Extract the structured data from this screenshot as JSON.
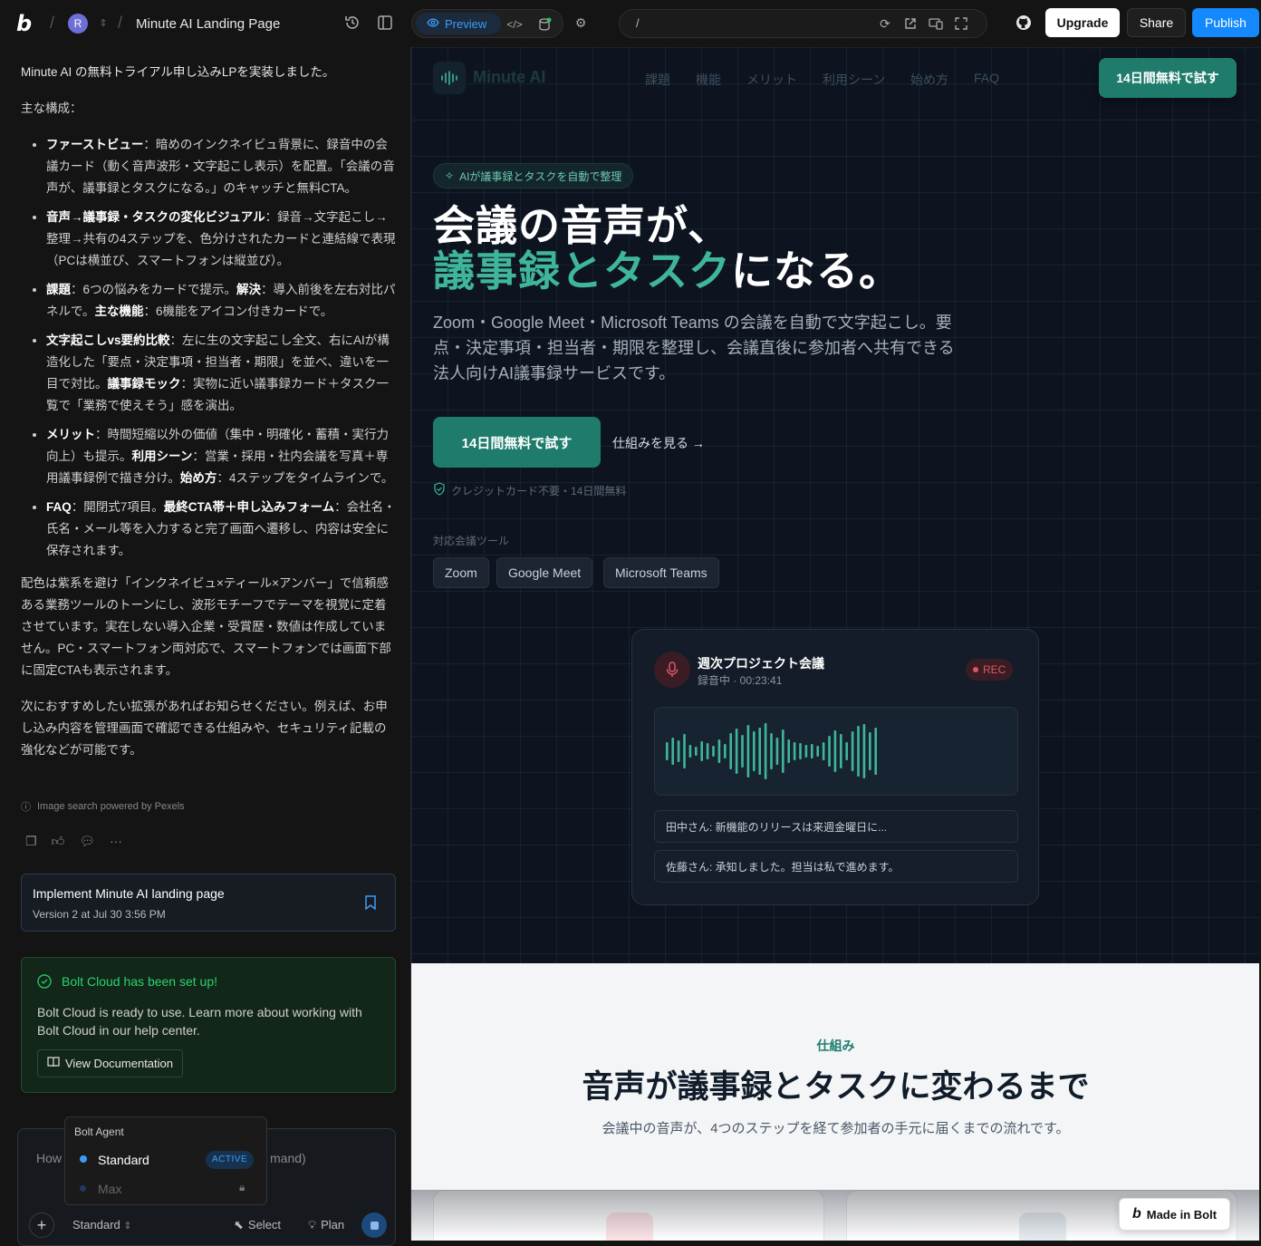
{
  "topbar": {
    "avatar_initial": "R",
    "project_title": "Minute AI Landing Page",
    "preview_label": "Preview",
    "url_path": "/",
    "upgrade_label": "Upgrade",
    "share_label": "Share",
    "publish_label": "Publish"
  },
  "chat": {
    "intro": "Minute AI の無料トライアル申し込みLPを実装しました。",
    "structure_heading": "主な構成：",
    "bullets": [
      {
        "bold": "ファーストビュー",
        "text": "：暗めのインクネイビュ背景に、録音中の会議カード（動く音声波形・文字起こし表示）を配置。「会議の音声が、議事録とタスクになる。」のキャッチと無料CTA。"
      },
      {
        "bold": "音声→議事録・タスクの変化ビジュアル",
        "text": "：録音→文字起こし→整理→共有の4ステップを、色分けされたカードと連結線で表現（PCは横並び、スマートフォンは縦並び）。"
      },
      {
        "bold": "課題",
        "text": "：6つの悩みをカードで提示。",
        "bold2": "解決",
        "text2": "：導入前後を左右対比パネルで。",
        "bold3": "主な機能",
        "text3": "：6機能をアイコン付きカードで。"
      },
      {
        "bold": "文字起こしvs要約比較",
        "text": "：左に生の文字起こし全文、右にAIが構造化した「要点・決定事項・担当者・期限」を並べ、違いを一目で対比。",
        "bold2": "議事録モック",
        "text2": "：実物に近い議事録カード＋タスク一覧で「業務で使えそう」感を演出。"
      },
      {
        "bold": "メリット",
        "text": "：時間短縮以外の価値（集中・明確化・蓄積・実行力向上）も提示。",
        "bold2": "利用シーン",
        "text2": "：営業・採用・社内会議を写真＋専用議事録例で描き分け。",
        "bold3": "始め方",
        "text3": "：4ステップをタイムラインで。"
      },
      {
        "bold": "FAQ",
        "text": "：開閉式7項目。",
        "bold2": "最終CTA帯＋申し込みフォーム",
        "text2": "：会社名・氏名・メール等を入力すると完了画面へ遷移し、内容は安全に保存されます。"
      }
    ],
    "para_color": "配色は紫系を避け「インクネイビュ×ティール×アンバー」で信頼感ある業務ツールのトーンにし、波形モチーフでテーマを視覚に定着させています。実在しない導入企業・受賞歴・数値は作成していません。PC・スマートフォン両対応で、スマートフォンでは画面下部に固定CTAも表示されます。",
    "para_next": "次におすすめしたい拡張があればお知らせください。例えば、お申し込み内容を管理画面で確認できる仕組みや、セキュリティ記載の強化などが可能です。",
    "pexels_note": "Image search powered by Pexels",
    "version_title": "Implement Minute AI landing page",
    "version_meta": "Version 2 at Jul 30 3:56 PM",
    "cloud_title": "Bolt Cloud has been set up!",
    "cloud_body": "Bolt Cloud is ready to use. Learn more about working with Bolt Cloud in our help center.",
    "cloud_button": "View Documentation",
    "input_placeholder_left": "How",
    "input_placeholder_right": "mand)",
    "agent_menu_title": "Bolt Agent",
    "agent_standard": "Standard",
    "agent_active_badge": "ACTIVE",
    "agent_max": "Max",
    "mode_label": "Standard",
    "select_label": "Select",
    "plan_label": "Plan"
  },
  "site": {
    "brand": "Minute AI",
    "nav": [
      "課題",
      "機能",
      "メリット",
      "利用シーン",
      "始め方",
      "FAQ"
    ],
    "nav_cta": "14日間無料で試す",
    "badge": "AIが議事録とタスクを自動で整理",
    "headline_line1": "会議の音声が、",
    "headline_accent": "議事録とタスク",
    "headline_tail": "になる。",
    "subtitle": "Zoom・Google Meet・Microsoft Teams の会議を自動で文字起こし。要点・決定事項・担当者・期限を整理し、会議直後に参加者へ共有できる 法人向けAI議事録サービスです。",
    "cta_primary": "14日間無料で試す",
    "cta_secondary": "仕組みを見る →",
    "note": "クレジットカード不要・14日間無料",
    "tools_label": "対応会議ツール",
    "tools": [
      "Zoom",
      "Google Meet",
      "Microsoft Teams"
    ],
    "meeting": {
      "title": "週次プロジェクト会議",
      "status": "録音中 · 00:23:41",
      "rec": "REC",
      "transcript": [
        "田中さん: 新機能のリリースは来週金曜日に...",
        "佐藤さん: 承知しました。担当は私で進めます。"
      ]
    },
    "section2": {
      "eyebrow": "仕組み",
      "title": "音声が議事録とタスクに変わるまで",
      "subtitle": "会議中の音声が、4つのステップを経て参加者の手元に届くまでの流れです。"
    },
    "made_in_bolt": "Made in Bolt"
  },
  "colors": {
    "accent_teal": "#3fb69a",
    "cta_teal": "#1f7c6c",
    "publish_blue": "#1389fd",
    "hero_bg": "#0d1420"
  }
}
